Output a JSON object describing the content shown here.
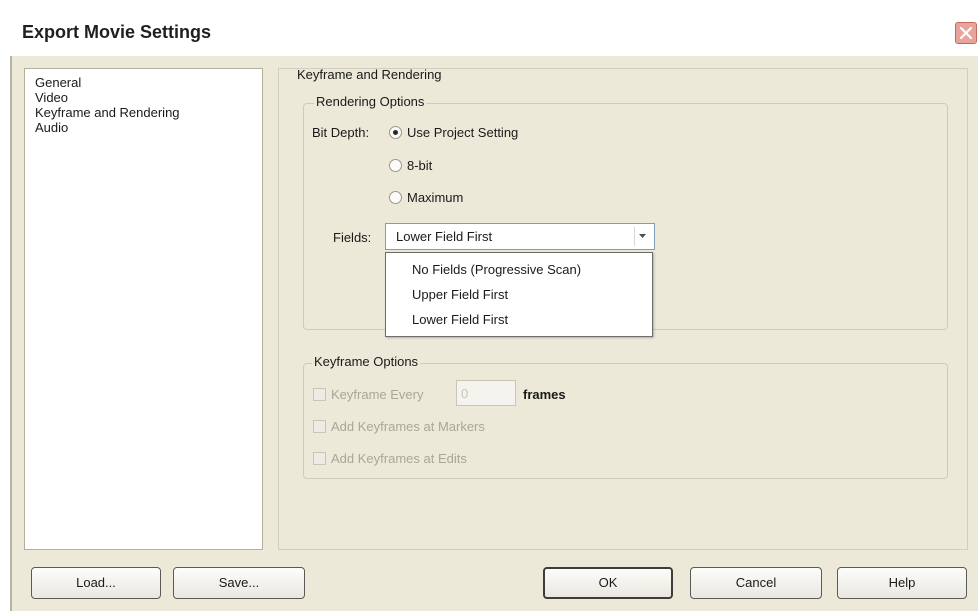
{
  "window": {
    "title": "Export Movie Settings"
  },
  "sidebar": {
    "items": [
      {
        "label": "General"
      },
      {
        "label": "Video"
      },
      {
        "label": "Keyframe and Rendering"
      },
      {
        "label": "Audio"
      }
    ]
  },
  "main": {
    "section_title": "Keyframe and Rendering",
    "rendering": {
      "legend": "Rendering Options",
      "bit_depth_label": "Bit Depth:",
      "bit_depth_options": [
        {
          "label": "Use Project Setting",
          "selected": true
        },
        {
          "label": "8-bit",
          "selected": false
        },
        {
          "label": "Maximum",
          "selected": false
        }
      ],
      "fields_label": "Fields:",
      "fields_value": "Lower Field First",
      "fields_options": [
        "No Fields (Progressive Scan)",
        "Upper Field First",
        "Lower Field First"
      ]
    },
    "keyframe": {
      "legend": "Keyframe Options",
      "keyframe_every_label": "Keyframe Every",
      "keyframe_every_value": "0",
      "frames_label": "frames",
      "add_at_markers_label": "Add Keyframes at Markers",
      "add_at_edits_label": "Add Keyframes at Edits"
    }
  },
  "buttons": {
    "load": "Load...",
    "save": "Save...",
    "ok": "OK",
    "cancel": "Cancel",
    "help": "Help"
  }
}
